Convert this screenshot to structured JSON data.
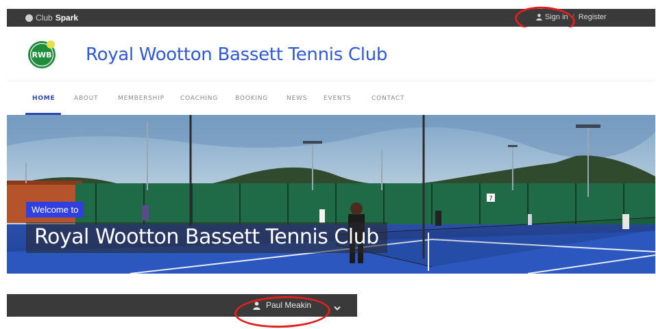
{
  "topbar": {
    "brand_prefix": "Club",
    "brand_suffix": "Spark",
    "sign_in": "Sign in",
    "separator": "/",
    "register": "Register"
  },
  "header": {
    "club_name": "Royal Wootton Bassett Tennis Club",
    "logo_text": "RWB"
  },
  "nav": {
    "items": [
      {
        "label": "Home",
        "active": true
      },
      {
        "label": "About"
      },
      {
        "label": "Membership"
      },
      {
        "label": "Coaching"
      },
      {
        "label": "Booking"
      },
      {
        "label": "News"
      },
      {
        "label": "Events"
      },
      {
        "label": "Contact"
      }
    ]
  },
  "hero": {
    "welcome": "Welcome to",
    "title": "Royal Wootton Bassett Tennis Club",
    "fence_signs": [
      "7"
    ]
  },
  "userbar": {
    "user_name": "Paul Meakin"
  },
  "colors": {
    "topbar": "#3a3a3a",
    "brand_blue": "#2f59d8",
    "nav_active": "#2a46b5",
    "welcome_badge": "#2f3fe0",
    "annotation_red": "#e01f1f",
    "court_blue": "#2c4fb8"
  },
  "icons": {
    "clubspark": "clubspark-logo-icon",
    "person": "person-icon",
    "chevron": "chevron-down-icon"
  }
}
